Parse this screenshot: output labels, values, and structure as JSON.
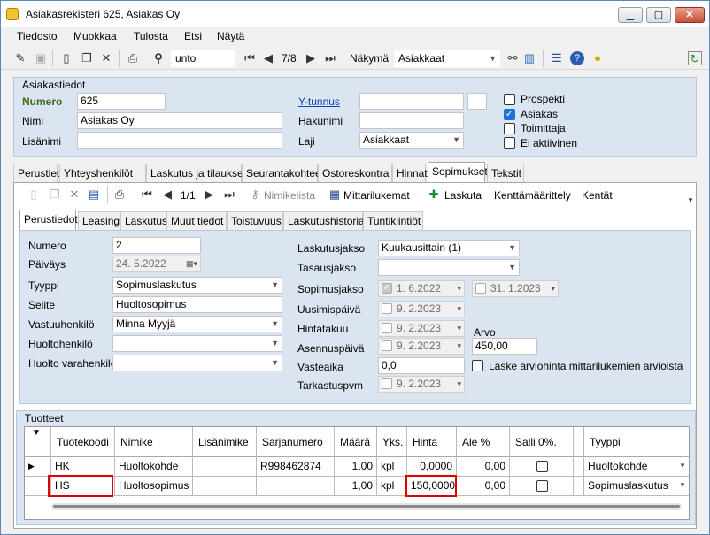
{
  "window": {
    "title": "Asiakasrekisteri 625, Asiakas Oy",
    "min": "▁",
    "max": "▢",
    "close": "✕"
  },
  "menu": [
    "Tiedosto",
    "Muokkaa",
    "Tulosta",
    "Etsi",
    "Näytä"
  ],
  "toolbar": {
    "search_value": "unto",
    "record_pos": "7/8",
    "view_label": "Näkymä",
    "view_value": "Asiakkaat"
  },
  "header": {
    "section_title": "Asiakastiedot",
    "numero_label": "Numero",
    "numero_value": "625",
    "nimi_label": "Nimi",
    "nimi_value": "Asiakas Oy",
    "lisanimi_label": "Lisänimi",
    "lisanimi_value": "",
    "ytunnus_label": "Y-tunnus",
    "ytunnus_value": "",
    "hakunimi_label": "Hakunimi",
    "hakunimi_value": "",
    "laji_label": "Laji",
    "laji_value": "Asiakkaat",
    "checks": [
      {
        "label": "Prospekti",
        "checked": false
      },
      {
        "label": "Asiakas",
        "checked": true
      },
      {
        "label": "Toimittaja",
        "checked": false
      },
      {
        "label": "Ei aktiivinen",
        "checked": false
      }
    ]
  },
  "main_tabs": [
    "Perustiedot",
    "Yhteyshenkilöt",
    "Laskutus ja tilaukset",
    "Seurantakohteet",
    "Ostoreskontra",
    "Hinnat",
    "Sopimukset",
    "Tekstit"
  ],
  "main_tab_active": "Sopimukset",
  "sub_toolbar": {
    "record_pos": "1/1",
    "nimikelista": "Nimikelista",
    "mittarilukemat": "Mittarilukemat",
    "laskuta": "Laskuta",
    "kenttamaarittely": "Kenttämäärittely",
    "kentat": "Kentät"
  },
  "sub_tabs": [
    "Perustiedot",
    "Leasing",
    "Laskutus",
    "Muut tiedot",
    "Toistuvuus",
    "Laskutushistoria",
    "Tuntikiintiöt"
  ],
  "sub_tab_active": "Perustiedot",
  "contract": {
    "numero_label": "Numero",
    "numero_value": "2",
    "paivays_label": "Päiväys",
    "paivays_value": "24.  5.2022",
    "tyyppi_label": "Tyyppi",
    "tyyppi_value": "Sopimuslaskutus",
    "selite_label": "Selite",
    "selite_value": "Huoltosopimus",
    "vastuuhenkilo_label": "Vastuuhenkilö",
    "vastuuhenkilo_value": "Minna Myyjä",
    "huoltohenkilo_label": "Huoltohenkilö",
    "huoltohenkilo_value": "",
    "huoltovara_label": "Huolto varahenkilö",
    "huoltovara_value": "",
    "laskutusjakso_label": "Laskutusjakso",
    "laskutusjakso_value": "Kuukausittain (1)",
    "tasausjakso_label": "Tasausjakso",
    "tasausjakso_value": "",
    "sopimusjakso_label": "Sopimusjakso",
    "sopimusjakso_start": "1.  6.2022",
    "sopimusjakso_end": "31.  1.2023",
    "uusimispaiva_label": "Uusimispäivä",
    "uusimispaiva_value": "9.  2.2023",
    "hintatakuu_label": "Hintatakuu",
    "hintatakuu_value": "9.  2.2023",
    "asennuspaiva_label": "Asennuspäivä",
    "asennuspaiva_value": "9.  2.2023",
    "vasteaika_label": "Vasteaika",
    "vasteaika_value": "0,0",
    "tarkastuspvm_label": "Tarkastuspvm",
    "tarkastuspvm_value": "9.  2.2023",
    "arvo_label": "Arvo",
    "arvo_value": "450,00",
    "laske_label": "Laske arviohinta mittarilukemien arvioista"
  },
  "products": {
    "section_title": "Tuotteet",
    "columns": [
      "Tuotekoodi",
      "Nimike",
      "Lisänimike",
      "Sarjanumero",
      "Määrä",
      "Yks.",
      "Hinta",
      "Ale %",
      "Salli 0%.",
      "Tyyppi"
    ],
    "rows": [
      [
        "HK",
        "Huoltokohde",
        "",
        "R998462874",
        "1,00",
        "kpl",
        "0,0000",
        "0,00",
        "",
        "Huoltokohde"
      ],
      [
        "HS",
        "Huoltosopimus",
        "",
        "",
        "1,00",
        "kpl",
        "150,0000",
        "0,00",
        "",
        "Sopimuslaskutus"
      ]
    ]
  },
  "colors": {
    "panel": "#dbe5f1",
    "highlight": "#e00000",
    "link": "#0645ad",
    "numero_label": "#3c6b1e"
  }
}
